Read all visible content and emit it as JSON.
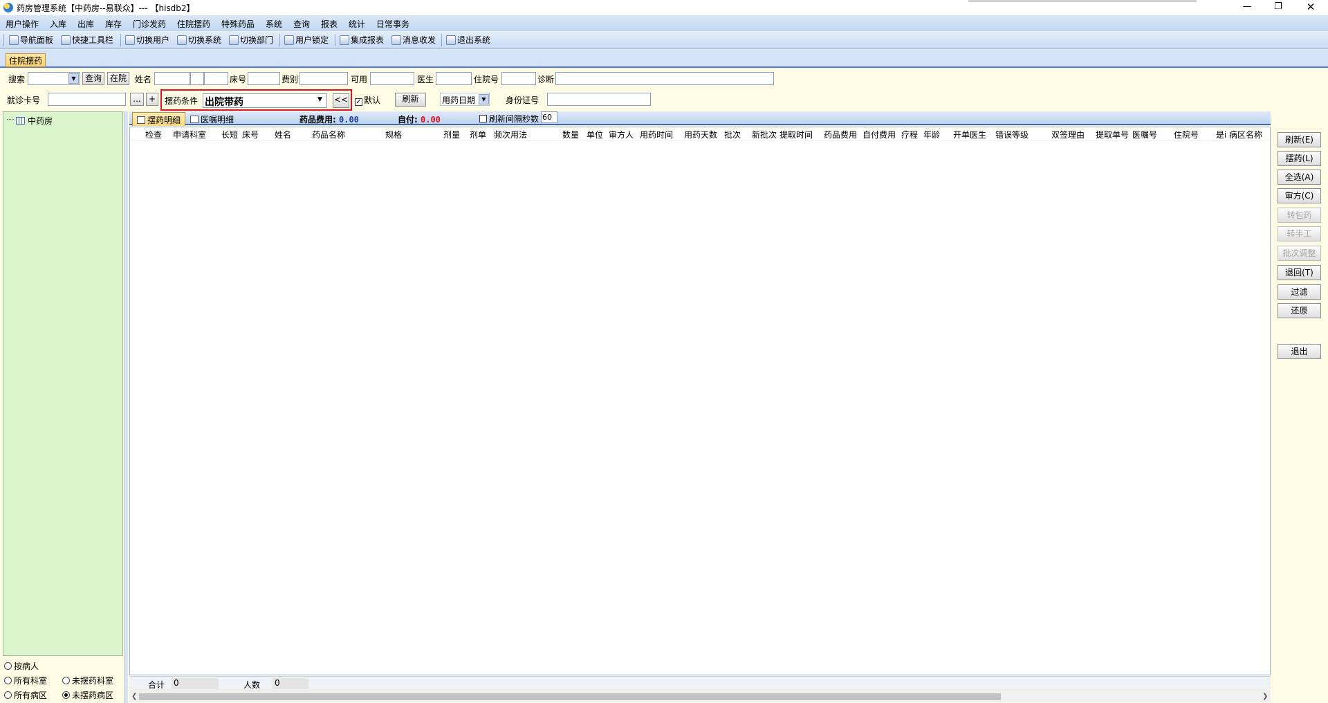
{
  "window": {
    "title": "药房管理系统【中药房--易联众】--- 【hisdb2】",
    "min_label": "—",
    "max_label": "❐",
    "close_label": "✕"
  },
  "menu": [
    "用户操作",
    "入库",
    "出库",
    "库存",
    "门诊发药",
    "住院摆药",
    "特殊药品",
    "系统",
    "查询",
    "报表",
    "统计",
    "日常事务"
  ],
  "toolbar": [
    "导航面板",
    "快捷工具栏",
    "切换用户",
    "切换系统",
    "切换部门",
    "用户锁定",
    "集成报表",
    "消息收发",
    "退出系统"
  ],
  "tab": "住院摆药",
  "filters": {
    "search_label": "搜索",
    "query_button": "查询",
    "inhospital_button": "在院",
    "name_label": "姓名",
    "bed_label": "床号",
    "fee_type_label": "费别",
    "available_label": "可用",
    "doctor_label": "医生",
    "admission_label": "住院号",
    "diagnosis_label": "诊断",
    "card_label": "就诊卡号",
    "ellipsis_button": "...",
    "plus_button": "+",
    "condition_label": "摆药条件",
    "condition_value": "出院带药",
    "back_button": "<<",
    "default_label": "默认",
    "refresh_button": "刷新",
    "date_label": "用药日期",
    "idcard_label": "身份证号"
  },
  "tree": {
    "root": "中药房"
  },
  "left_options": {
    "by_patient": "按病人",
    "all_depts": "所有科室",
    "undispensed_depts": "未摆药科室",
    "all_wards": "所有病区",
    "undispensed_wards": "未摆药病区",
    "selected": "未摆药病区"
  },
  "subtabs": [
    "摆药明细",
    "医嘱明细"
  ],
  "fees": {
    "drug_label": "药品费用:",
    "drug_value": "0.00",
    "self_label": "自付:",
    "self_value": "0.00",
    "auto_refresh_label": "刷新间隔秒数",
    "auto_refresh_value": "60"
  },
  "columns": [
    "检查",
    "申请科室",
    "长短",
    "床号",
    "姓名",
    "药品名称",
    "规格",
    "剂量",
    "剂单",
    "频次用法",
    "数量",
    "单位",
    "审方人",
    "用药时间",
    "用药天数",
    "批次",
    "新批次",
    "提取时间",
    "药品费用",
    "自付费用",
    "疗程",
    "年龄",
    "开单医生",
    "错误等级",
    "双签理由",
    "提取单号",
    "医嘱号",
    "住院号",
    "是i",
    "病区名称"
  ],
  "footer": {
    "total_label": "合计",
    "total_value": "0",
    "count_label": "人数",
    "count_value": "0"
  },
  "right_buttons": [
    {
      "label": "刷新(E)",
      "enabled": true
    },
    {
      "label": "摆药(L)",
      "enabled": true
    },
    {
      "label": "全选(A)",
      "enabled": true
    },
    {
      "label": "审方(C)",
      "enabled": true
    },
    {
      "label": "转包药",
      "enabled": false
    },
    {
      "label": "转手工",
      "enabled": false
    },
    {
      "label": "批次调整",
      "enabled": false
    },
    {
      "label": "退回(T)",
      "enabled": true
    },
    {
      "label": "过滤",
      "enabled": true
    },
    {
      "label": "还原",
      "enabled": true
    },
    {
      "label": "退出",
      "enabled": true
    }
  ],
  "colors": {
    "accent_red": "#e0141e",
    "fee_blue": "#1f3d9c",
    "fee_red": "#e0141e",
    "tree_green": "#daf5cb",
    "panel_yellow": "#fdfbe3"
  }
}
